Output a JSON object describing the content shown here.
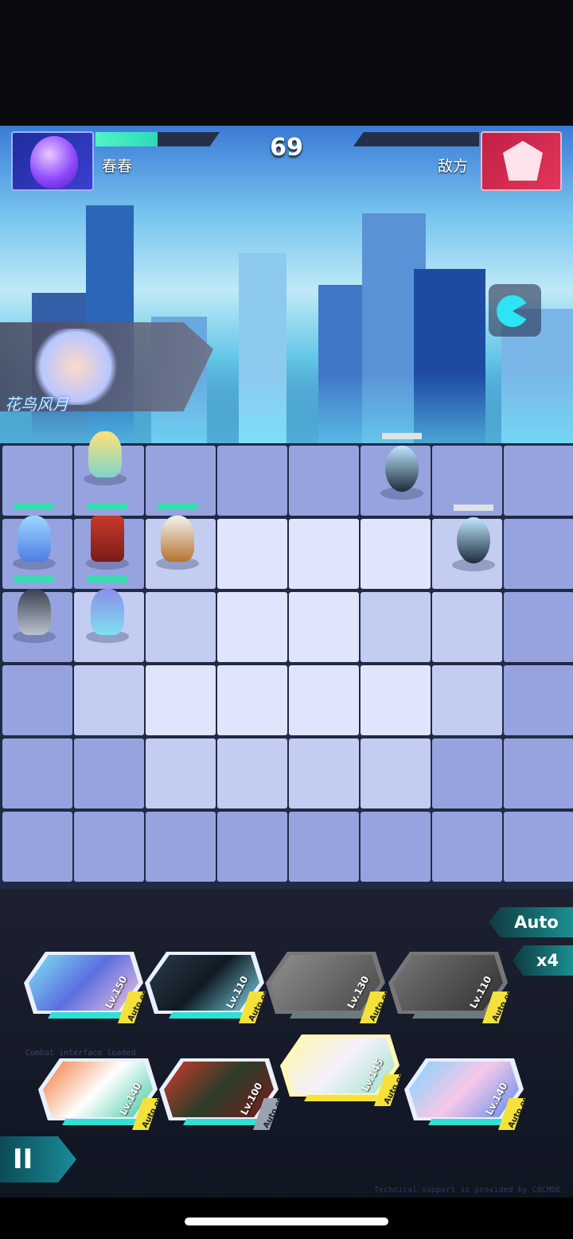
{
  "header": {
    "player_name": "春春",
    "enemy_name": "敌方",
    "timer": "69",
    "player_hp_fraction": 0.5,
    "enemy_hp_fraction": 0.0
  },
  "skill_banner": {
    "label": "花鸟风月"
  },
  "controls": {
    "auto_label": "Auto",
    "speed_label": "x4",
    "pause_label": "II"
  },
  "cards_top": [
    {
      "level": "Lv.150",
      "auto": "Auto on",
      "active": true
    },
    {
      "level": "Lv.110",
      "auto": "Auto on",
      "active": true
    },
    {
      "level": "Lv.130",
      "auto": "Auto on",
      "active": false
    },
    {
      "level": "Lv.110",
      "auto": "Auto on",
      "active": false
    }
  ],
  "cards_bottom": [
    {
      "level": "Lv.140",
      "auto": "Auto on",
      "active": true
    },
    {
      "level": "Lv.100",
      "auto": "Auto off",
      "active": true
    },
    {
      "level": "Lv.145",
      "auto": "Auto on",
      "active": true,
      "selected": true
    },
    {
      "level": "Lv.140",
      "auto": "Auto on",
      "active": true
    }
  ],
  "decorations": {
    "console_text": "Combat interface loaded",
    "tech_support": "Technical support is provided by CBCMOE"
  },
  "colors": {
    "player_accent": "#3b3fd0",
    "enemy_accent": "#e2365c",
    "hp_fill": "#33e0b0",
    "auto_tag": "#f4e23a"
  }
}
